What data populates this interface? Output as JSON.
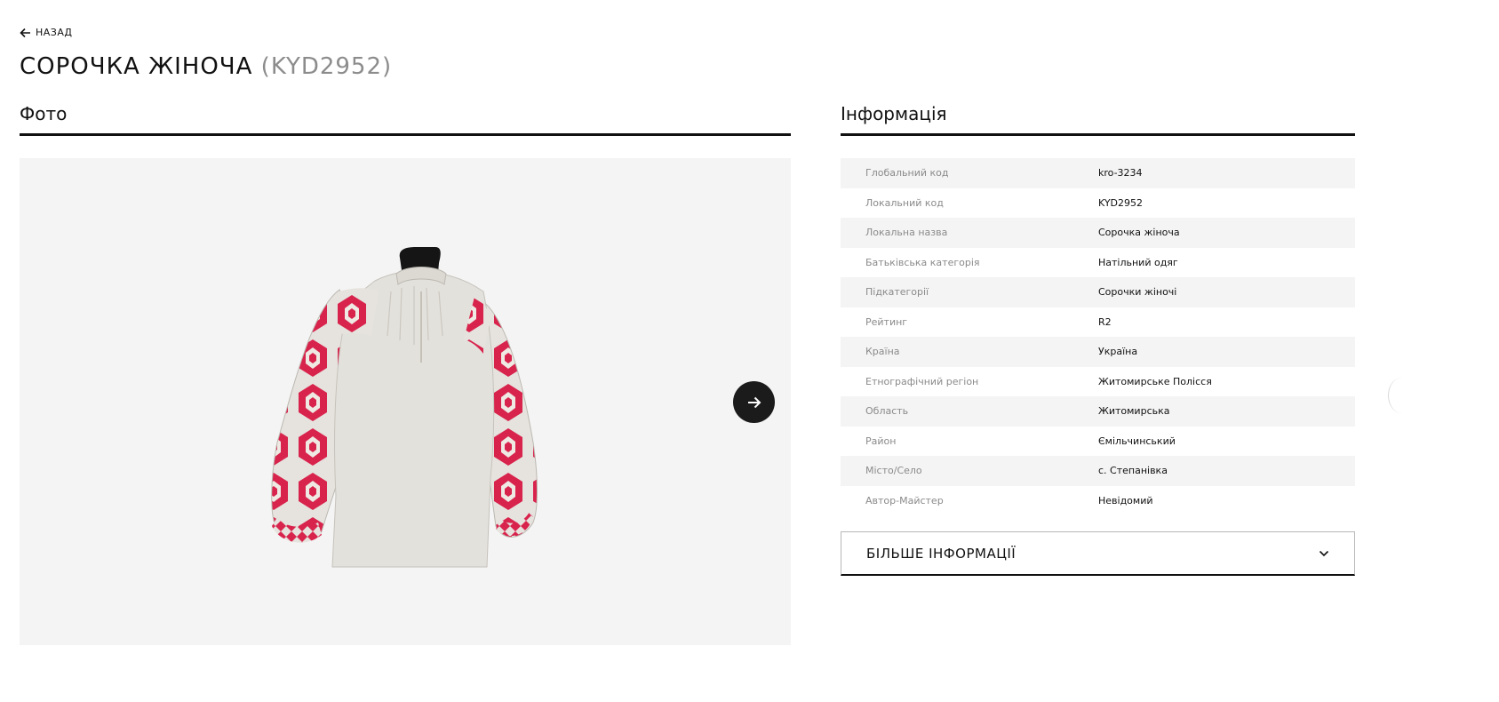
{
  "nav": {
    "back_label": "НАЗАД"
  },
  "page": {
    "title": "СОРОЧКА ЖІНОЧА",
    "code": "(KYD2952)"
  },
  "photo_section": {
    "heading": "Фото",
    "image_alt": "Сорочка жіноча"
  },
  "info_section": {
    "heading": "Інформація",
    "rows": [
      {
        "label": "Глобальний код",
        "value": "kro-3234"
      },
      {
        "label": "Локальний код",
        "value": "KYD2952"
      },
      {
        "label": "Локальна назва",
        "value": "Сорочка жіноча"
      },
      {
        "label": "Батьківська категорія",
        "value": "Натільний одяг"
      },
      {
        "label": "Підкатегорії",
        "value": "Сорочки жіночі"
      },
      {
        "label": "Рейтинг",
        "value": "R2"
      },
      {
        "label": "Країна",
        "value": "Україна"
      },
      {
        "label": "Етнографічний регіон",
        "value": "Житомирське Полісся"
      },
      {
        "label": "Область",
        "value": "Житомирська"
      },
      {
        "label": "Район",
        "value": "Ємільчинський"
      },
      {
        "label": "Місто/Село",
        "value": "с. Степанівка"
      },
      {
        "label": "Автор-Майстер",
        "value": "Невідомий"
      }
    ],
    "more_label": "БІЛЬШЕ ІНФОРМАЦІЇ"
  },
  "colors": {
    "accent_embroidery": "#d8234c",
    "linen": "#e3e1dc",
    "panel_bg": "#f4f4f4"
  },
  "icons": [
    "arrow-left-icon",
    "arrow-right-icon",
    "chevron-down-icon"
  ]
}
